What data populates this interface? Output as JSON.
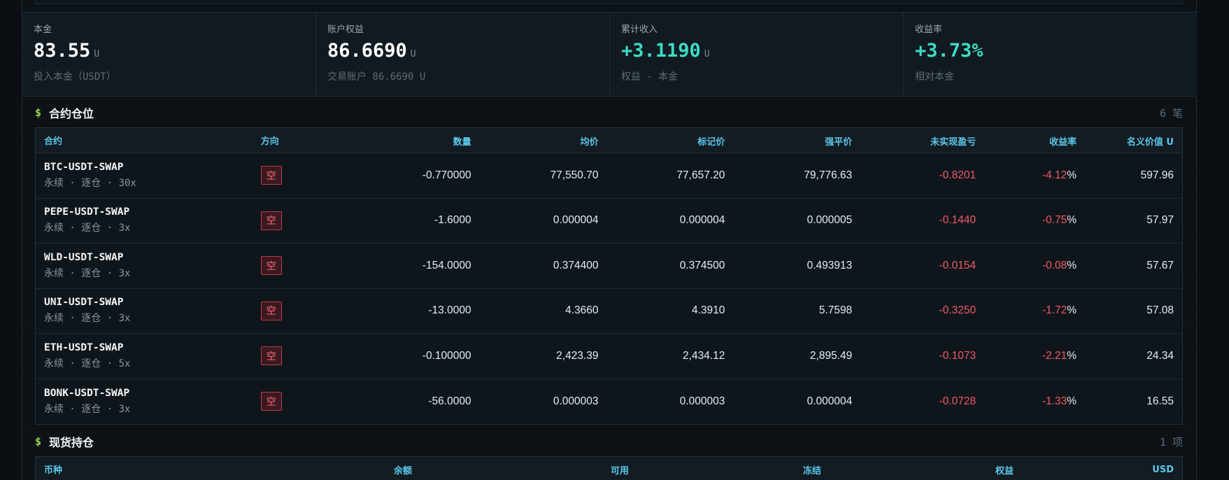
{
  "stats": [
    {
      "label": "本金",
      "value": "83.55",
      "unit": "U",
      "sub": "投入本金（USDT）",
      "positive": false
    },
    {
      "label": "账户权益",
      "value": "86.6690",
      "unit": "U",
      "sub": "交易账户 86.6690 U",
      "positive": false
    },
    {
      "label": "累计收入",
      "value": "+3.1190",
      "unit": "U",
      "sub": "权益 - 本金",
      "positive": true
    },
    {
      "label": "收益率",
      "value": "+3.73%",
      "unit": "",
      "sub": "相对本金",
      "positive": true
    }
  ],
  "contracts": {
    "symbol": "$",
    "title": "合约仓位",
    "count": "6 笔",
    "headers": [
      "合约",
      "方向",
      "数量",
      "均价",
      "标记价",
      "强平价",
      "未实现盈亏",
      "收益率",
      "名义价值 U"
    ],
    "rows": [
      {
        "name": "BTC-USDT-SWAP",
        "meta": "永续 · 逐仓 · 30x",
        "dir": "空",
        "qty": "-0.770000",
        "avg": "77,550.70",
        "mark": "77,657.20",
        "liq": "79,776.63",
        "pnl": "-0.8201",
        "roe": "-4.12",
        "notional": "597.96"
      },
      {
        "name": "PEPE-USDT-SWAP",
        "meta": "永续 · 逐仓 · 3x",
        "dir": "空",
        "qty": "-1.6000",
        "avg": "0.000004",
        "mark": "0.000004",
        "liq": "0.000005",
        "pnl": "-0.1440",
        "roe": "-0.75",
        "notional": "57.97"
      },
      {
        "name": "WLD-USDT-SWAP",
        "meta": "永续 · 逐仓 · 3x",
        "dir": "空",
        "qty": "-154.0000",
        "avg": "0.374400",
        "mark": "0.374500",
        "liq": "0.493913",
        "pnl": "-0.0154",
        "roe": "-0.08",
        "notional": "57.67"
      },
      {
        "name": "UNI-USDT-SWAP",
        "meta": "永续 · 逐仓 · 3x",
        "dir": "空",
        "qty": "-13.0000",
        "avg": "4.3660",
        "mark": "4.3910",
        "liq": "5.7598",
        "pnl": "-0.3250",
        "roe": "-1.72",
        "notional": "57.08"
      },
      {
        "name": "ETH-USDT-SWAP",
        "meta": "永续 · 逐仓 · 5x",
        "dir": "空",
        "qty": "-0.100000",
        "avg": "2,423.39",
        "mark": "2,434.12",
        "liq": "2,895.49",
        "pnl": "-0.1073",
        "roe": "-2.21",
        "notional": "24.34"
      },
      {
        "name": "BONK-USDT-SWAP",
        "meta": "永续 · 逐仓 · 3x",
        "dir": "空",
        "qty": "-56.0000",
        "avg": "0.000003",
        "mark": "0.000003",
        "liq": "0.000004",
        "pnl": "-0.0728",
        "roe": "-1.33",
        "notional": "16.55"
      }
    ],
    "pct_sign": "%"
  },
  "spot": {
    "symbol": "$",
    "title": "现货持仓",
    "count": "1 项",
    "headers": [
      "币种",
      "余额",
      "可用",
      "冻结",
      "权益",
      "USD"
    ]
  },
  "colors": {
    "accent": "#5cc7ea",
    "positive": "#3ddbc4",
    "negative": "#f0596a",
    "symbol": "#9bd84d"
  }
}
